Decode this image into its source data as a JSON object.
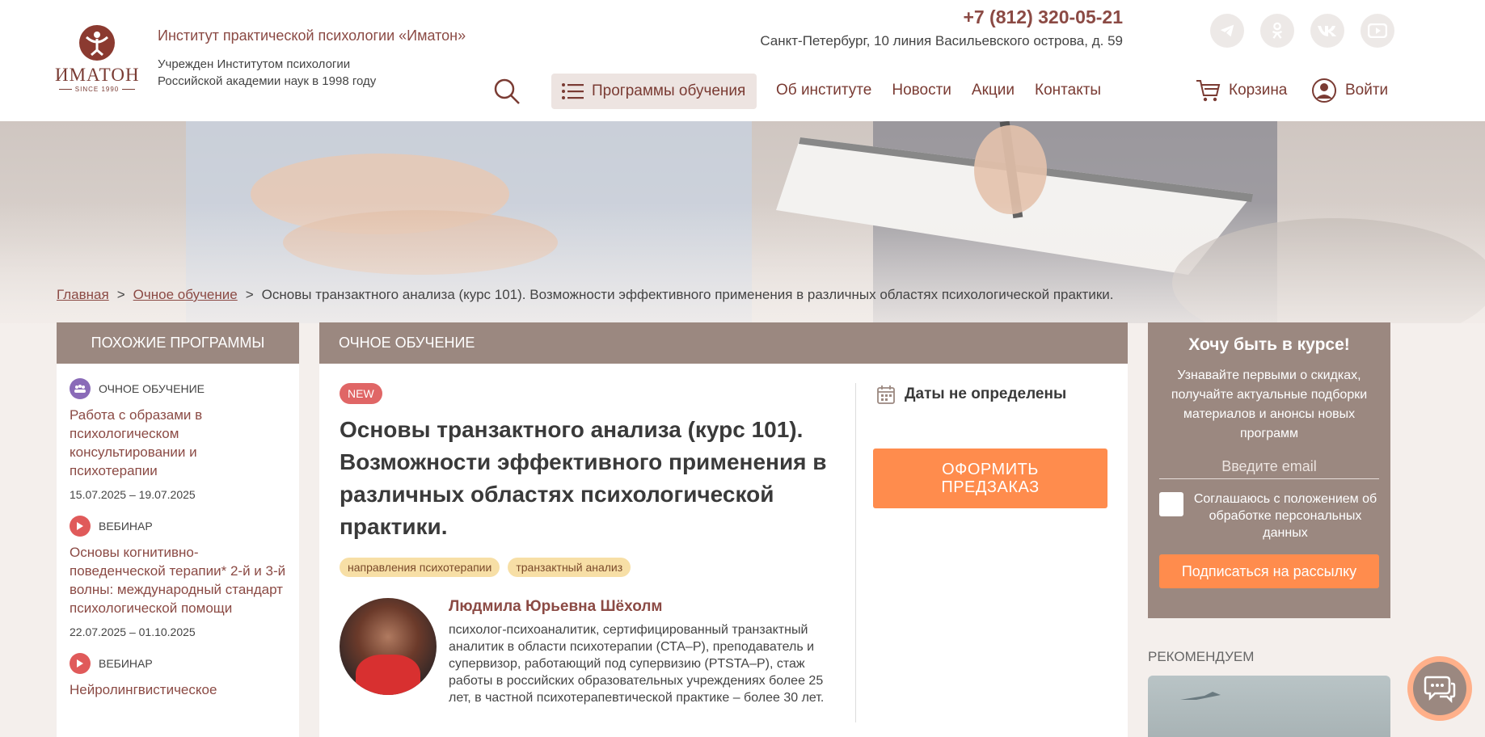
{
  "header": {
    "logo_name": "ИМАТОН",
    "logo_since": "SINCE 1990",
    "institute_name": "Институт практической психологии «Иматон»",
    "institute_sub_1": "Учрежден Институтом психологии",
    "institute_sub_2": "Российской академии наук в 1998 году",
    "phone": "+7 (812) 320-05-21",
    "address": "Санкт-Петербург, 10 линия Васильевского острова, д. 59",
    "socials": [
      "telegram-icon",
      "odnoklassniki-icon",
      "vk-icon",
      "youtube-icon"
    ],
    "programs_label": "Программы обучения",
    "nav": [
      "Об институте",
      "Новости",
      "Акции",
      "Контакты"
    ],
    "cart_label": "Корзина",
    "login_label": "Войти"
  },
  "breadcrumb": {
    "home": "Главная",
    "section": "Очное обучение",
    "current": "Основы транзактного анализа (курс 101). Возможности эффективного применения в различных областях психологической практики.",
    "sep": ">"
  },
  "sidebar": {
    "title": "ПОХОЖИЕ ПРОГРАММЫ",
    "items": [
      {
        "type": "ОЧНОЕ ОБУЧЕНИЕ",
        "title": "Работа с образами в психологическом консультировании и психотерапии",
        "date": "15.07.2025 – 19.07.2025"
      },
      {
        "type": "ВЕБИНАР",
        "title": "Основы когнитивно-поведенческой терапии* 2-й и 3-й волны: международный стандарт психологической помощи",
        "date": "22.07.2025 – 01.10.2025"
      },
      {
        "type": "ВЕБИНАР",
        "title": "Нейролингвистическое",
        "date": ""
      }
    ]
  },
  "main": {
    "header": "ОЧНОЕ ОБУЧЕНИЕ",
    "badge": "NEW",
    "title": "Основы транзактного анализа (курс 101). Возможности эффективного применения в различных областях психологической практики.",
    "tags": [
      "направления психотерапии",
      "транзактный анализ"
    ],
    "author_name": "Людмила Юрьевна Шёхолм",
    "author_desc": "психолог-психоаналитик, сертифицированный транзактный аналитик в области психотерапии (СТА–Р), преподаватель и супервизор, работающий под супервизию (PTSTA–Р), стаж работы в российских образовательных учреждениях более 25 лет, в частной психотерапевтической практике – более 30 лет.",
    "dates": "Даты не определены",
    "preorder_line1": "ОФОРМИТЬ",
    "preorder_line2": "ПРЕДЗАКАЗ"
  },
  "subscribe": {
    "title": "Хочу быть в курсе!",
    "text": "Узнавайте первыми о скидках, получайте актуальные подборки материалов и анонсы новых программ",
    "placeholder": "Введите email",
    "consent": "Соглашаюсь с положением об обработке персональных данных",
    "button": "Подписаться на рассылку"
  },
  "recommend_label": "РЕКОМЕНДУЕМ",
  "colors": {
    "brand": "#8b4a44",
    "panel": "#9b8880",
    "accent": "#ff8c4d",
    "new_badge": "#e06666",
    "tag": "#f7dfa6"
  }
}
